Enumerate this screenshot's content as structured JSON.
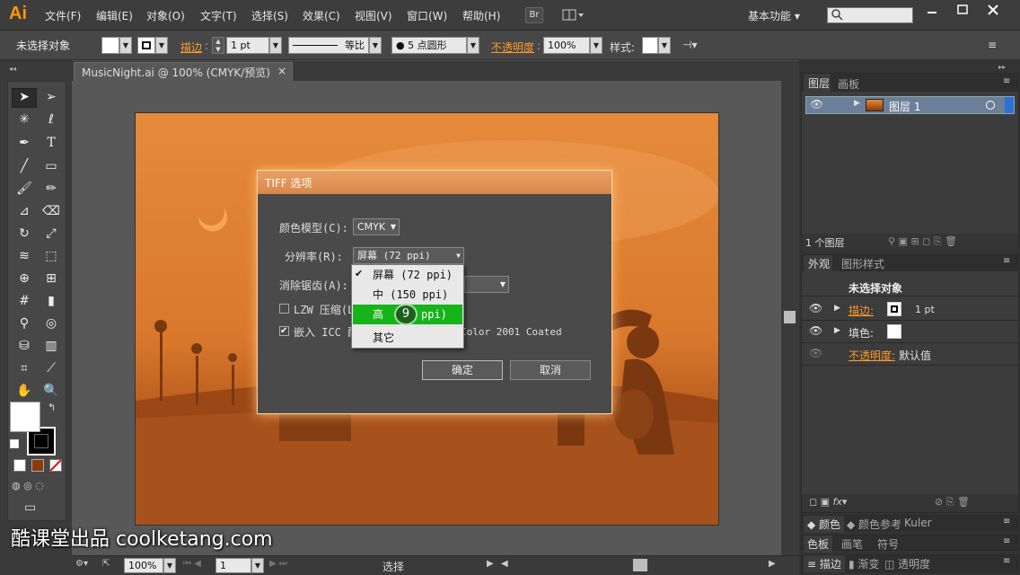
{
  "app": {
    "logo": "Ai"
  },
  "menu": [
    "文件(F)",
    "编辑(E)",
    "对象(O)",
    "文字(T)",
    "选择(S)",
    "效果(C)",
    "视图(V)",
    "窗口(W)",
    "帮助(H)"
  ],
  "menubar": {
    "br_label": "Br",
    "workspace": "基本功能"
  },
  "control": {
    "selection_status": "未选择对象",
    "stroke_label": "描边",
    "stroke_weight": "1 pt",
    "stroke_profile": "等比",
    "brush": "5 点圆形",
    "opacity_label": "不透明度",
    "opacity_value": "100%",
    "style_label": "样式"
  },
  "document_tab": {
    "title": "MusicNight.ai @ 100% (CMYK/预览)",
    "close": "×"
  },
  "dialog": {
    "title": "TIFF 选项",
    "color_model_label": "颜色模型(C):",
    "color_model_value": "CMYK",
    "resolution_label": "分辨率(R):",
    "resolution_value": "屏幕 (72 ppi)",
    "antialias_label": "消除锯齿(A):",
    "lzw_label": "LZW 压缩(L)",
    "icc_label": "嵌入 ICC 配",
    "icc_profile_tail": "Color 2001 Coated",
    "lzw_checked": false,
    "icc_checked": true,
    "ok": "确定",
    "cancel": "取消"
  },
  "dropdown": {
    "items": [
      "屏幕 (72 ppi)",
      "中 (150 ppi)",
      "高 (300 ppi)",
      "其它"
    ],
    "checked_index": 0,
    "highlighted_index": 2,
    "high_visible_prefix": "高",
    "high_visible_suffix": "ppi)",
    "step_marker": "9",
    "highlight_color": "#17b31a"
  },
  "layers_panel": {
    "tabs": [
      "图层",
      "画板"
    ],
    "layer_name": "图层 1",
    "count": "1 个图层"
  },
  "appearance_panel": {
    "tabs": [
      "外观",
      "图形样式"
    ],
    "title": "未选择对象",
    "stroke_label": "描边:",
    "stroke_value": "1 pt",
    "fill_label": "填色:",
    "opacity_label": "不透明度:",
    "opacity_value": "默认值"
  },
  "color_panels": {
    "row1": [
      "颜色",
      "颜色参考",
      "Kuler"
    ],
    "row2": [
      "色板",
      "画笔",
      "符号"
    ],
    "row3": [
      "描边",
      "渐变",
      "透明度"
    ]
  },
  "statusbar": {
    "zoom": "100%",
    "page": "1",
    "status": "选择"
  },
  "watermark": "酷课堂出品 coolketang.com",
  "colors": {
    "accent_orange": "#ff9a2a",
    "artboard_orange": "#e58a3b",
    "menu_bg": "#3d3d3d"
  }
}
